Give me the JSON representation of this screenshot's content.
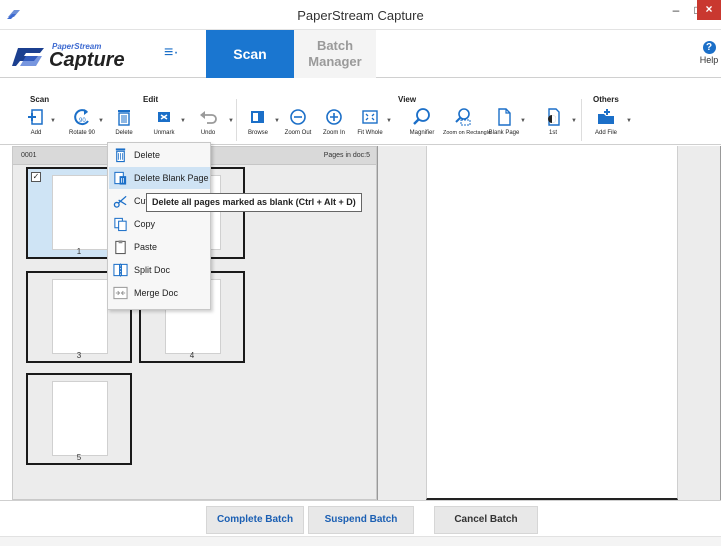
{
  "window": {
    "title": "PaperStream Capture",
    "minimize": "–",
    "maximize": "□",
    "close": "×"
  },
  "header": {
    "logo_top": "PaperStream",
    "logo_main": "Capture",
    "menu_icon": "≡·",
    "tabs": [
      {
        "label": "Scan",
        "active": true
      },
      {
        "label": "Batch Manager",
        "active": false
      }
    ],
    "help_icon": "?",
    "help_label": "Help"
  },
  "ribbon": {
    "groups": [
      "Scan",
      "Edit",
      "View",
      "Others"
    ],
    "tools": [
      {
        "label": "Add",
        "icon": "add-page-icon"
      },
      {
        "label": "Rotate 90",
        "icon": "rotate-icon"
      },
      {
        "label": "Delete",
        "icon": "trash-icon"
      },
      {
        "label": "Unmark",
        "icon": "unmark-icon"
      },
      {
        "label": "Undo",
        "icon": "undo-icon"
      },
      {
        "label": "Browse",
        "icon": "browse-icon"
      },
      {
        "label": "Zoom Out",
        "icon": "zoom-out-icon"
      },
      {
        "label": "Zoom In",
        "icon": "zoom-in-icon"
      },
      {
        "label": "Fit Whole",
        "icon": "fit-whole-icon"
      },
      {
        "label": "Magnifier",
        "icon": "magnifier-icon"
      },
      {
        "label": "Zoom on Rectangle",
        "icon": "zoom-rectangle-icon"
      },
      {
        "label": "Blank Page",
        "icon": "blank-page-icon"
      },
      {
        "label": "1st",
        "icon": "first-page-icon"
      },
      {
        "label": "Add File",
        "icon": "add-file-icon"
      }
    ]
  },
  "doc_panel": {
    "doc_id": "0001",
    "pages_label": "Pages in doc:5",
    "pages": [
      {
        "number": "1",
        "selected": true
      },
      {
        "number": "3",
        "selected": false
      },
      {
        "number": "4",
        "selected": false
      },
      {
        "number": "5",
        "selected": false
      }
    ]
  },
  "context_menu": {
    "items": [
      {
        "label": "Delete",
        "icon": "trash-icon"
      },
      {
        "label": "Delete Blank Page",
        "icon": "delete-blank-page-icon"
      },
      {
        "label": "Cut",
        "icon": "scissors-icon"
      },
      {
        "label": "Copy",
        "icon": "copy-icon"
      },
      {
        "label": "Paste",
        "icon": "paste-icon"
      },
      {
        "label": "Split Doc",
        "icon": "split-doc-icon"
      },
      {
        "label": "Merge Doc",
        "icon": "merge-doc-icon"
      }
    ],
    "hovered": "Delete Blank Page"
  },
  "tooltip": "Delete all pages marked as blank (Ctrl + Alt + D)",
  "bottom": {
    "complete": "Complete Batch",
    "suspend": "Suspend Batch",
    "cancel": "Cancel Batch"
  },
  "colors": {
    "accent": "#1a76d0",
    "close_button": "#c9382f",
    "selected_page": "#cfe4f5",
    "menu_hover": "#cfe3f4"
  }
}
